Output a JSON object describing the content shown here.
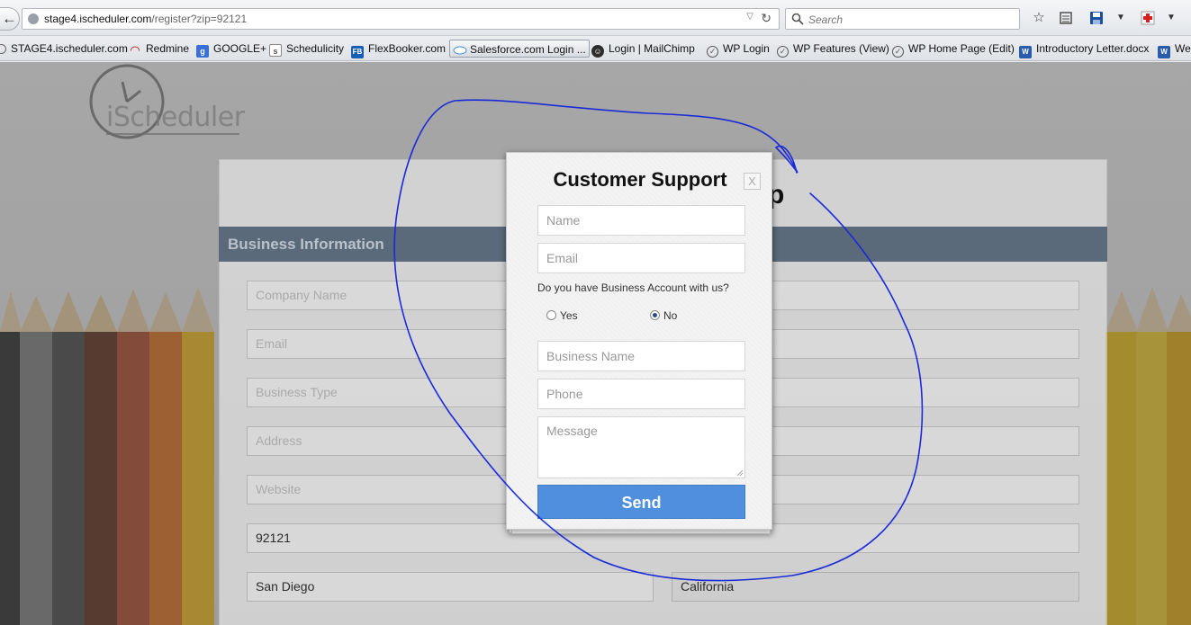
{
  "browser": {
    "url_host": "stage4.ischeduler.com",
    "url_path": "/register?zip=92121",
    "search_placeholder": "Search",
    "bookmarks": [
      {
        "label": "STAGE4.ischeduler.com",
        "icon": "clock-favicon-icon"
      },
      {
        "label": "Redmine",
        "icon": "redmine-favicon-icon"
      },
      {
        "label": "GOOGLE+",
        "icon": "google-plus-favicon-icon"
      },
      {
        "label": "Schedulicity",
        "icon": "schedulicity-favicon-icon"
      },
      {
        "label": "FlexBooker.com",
        "icon": "flexbooker-favicon-icon"
      },
      {
        "label": "Salesforce.com Login ...",
        "icon": "salesforce-cloud-icon"
      },
      {
        "label": "Login | MailChimp",
        "icon": "mailchimp-favicon-icon"
      },
      {
        "label": "WP Login",
        "icon": "wordpress-icon"
      },
      {
        "label": "WP Features (View)",
        "icon": "wordpress-icon"
      },
      {
        "label": "WP Home Page (Edit)",
        "icon": "wordpress-icon"
      },
      {
        "label": "Introductory Letter.docx",
        "icon": "word-doc-icon"
      },
      {
        "label": "We",
        "icon": "word-doc-icon"
      }
    ]
  },
  "page": {
    "logo_text": "iScheduler",
    "card_title_fragment": "p",
    "section_title": "Business Information",
    "fields": {
      "company_name": "Company Name",
      "email": "Email",
      "business_type": "Business Type",
      "address": "Address",
      "website": "Website",
      "zip": "92121",
      "city": "San Diego",
      "state": "California"
    }
  },
  "modal": {
    "title": "Customer Support",
    "close_label": "X",
    "name_placeholder": "Name",
    "email_placeholder": "Email",
    "question": "Do you have Business Account with us?",
    "radio_yes": "Yes",
    "radio_no": "No",
    "selected_option": "No",
    "business_name_placeholder": "Business Name",
    "phone_placeholder": "Phone",
    "message_placeholder": "Message",
    "send_label": "Send"
  },
  "colors": {
    "send_button": "#4f8fdd",
    "section_bar": "#5a6a7a",
    "annotation_ink": "#1a2ad8"
  }
}
